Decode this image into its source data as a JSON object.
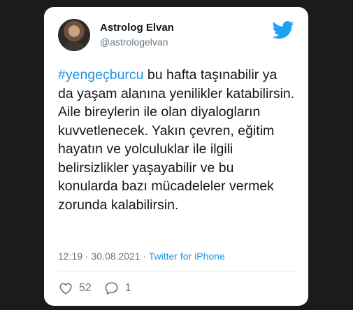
{
  "tweet": {
    "author": {
      "display_name": "Astrolog Elvan",
      "handle": "@astrologelvan"
    },
    "hashtag": "#yengeçburcu",
    "body": " bu hafta taşınabilir ya da yaşam alanına yenilikler katabilirsin. Aile bireylerin ile olan diyalogların kuvvetlenecek. Yakın çevren, eğitim hayatın ve yolculuklar ile ilgili belirsizlikler yaşayabilir ve bu konularda bazı mücadeleler vermek zorunda kalabilirsin.",
    "time": "12:19",
    "separator": " · ",
    "date": "30.08.2021",
    "separator2": " · ",
    "source": "Twitter for iPhone",
    "likes": "52",
    "replies": "1"
  },
  "icons": {
    "logo": "twitter-bird-icon",
    "like": "heart-icon",
    "reply": "speech-bubble-icon"
  },
  "colors": {
    "background": "#1b1b1b",
    "card": "#ffffff",
    "text": "#14171a",
    "muted": "#657786",
    "accent": "#1b95e0",
    "divider": "#e6ecf0"
  }
}
